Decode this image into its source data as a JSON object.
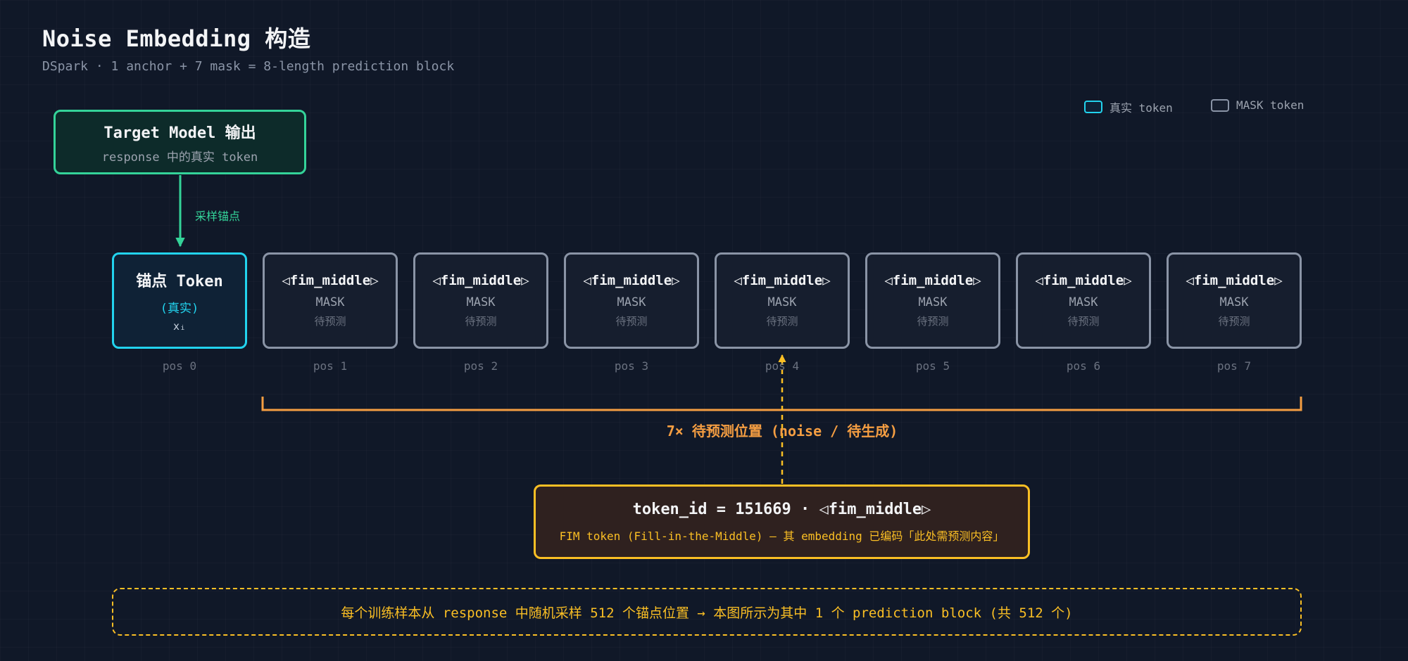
{
  "header": {
    "title": "Noise Embedding 构造",
    "subtitle": "DSpark · 1 anchor + 7 mask = 8-length prediction block"
  },
  "legend": [
    {
      "label": "真实 token",
      "color": "#22d3ee"
    },
    {
      "label": "MASK token",
      "color": "#8a94a6"
    }
  ],
  "target_model": {
    "title": "Target Model 输出",
    "subtitle": "response 中的真实 token"
  },
  "sample_arrow_label": "采样锚点",
  "anchor_token": {
    "title": "锚点 Token",
    "subtitle": "(真实)",
    "symbol": "xᵢ",
    "position": "pos 0"
  },
  "mask_tokens": [
    {
      "title": "◁fim_middle▷",
      "label": "MASK",
      "note": "待预测",
      "position": "pos 1"
    },
    {
      "title": "◁fim_middle▷",
      "label": "MASK",
      "note": "待预测",
      "position": "pos 2"
    },
    {
      "title": "◁fim_middle▷",
      "label": "MASK",
      "note": "待预测",
      "position": "pos 3"
    },
    {
      "title": "◁fim_middle▷",
      "label": "MASK",
      "note": "待预测",
      "position": "pos 4"
    },
    {
      "title": "◁fim_middle▷",
      "label": "MASK",
      "note": "待预测",
      "position": "pos 5"
    },
    {
      "title": "◁fim_middle▷",
      "label": "MASK",
      "note": "待预测",
      "position": "pos 6"
    },
    {
      "title": "◁fim_middle▷",
      "label": "MASK",
      "note": "待预测",
      "position": "pos 7"
    }
  ],
  "bracket_label": "7× 待预测位置 (noise / 待生成)",
  "fim_token": {
    "title": "token_id = 151669 · ◁fim_middle▷",
    "subtitle": "FIM token (Fill-in-the-Middle) — 其 embedding 已编码「此处需预测内容」"
  },
  "footnote": "每个训练样本从 response 中随机采样 512 个锚点位置 → 本图所示为其中 1 个 prediction block (共 512 个)",
  "colors": {
    "anchor": "#22d3ee",
    "mask": "#8a94a6",
    "target": "#34d399",
    "bracket": "#f59e42",
    "fim": "#fbbf24"
  }
}
